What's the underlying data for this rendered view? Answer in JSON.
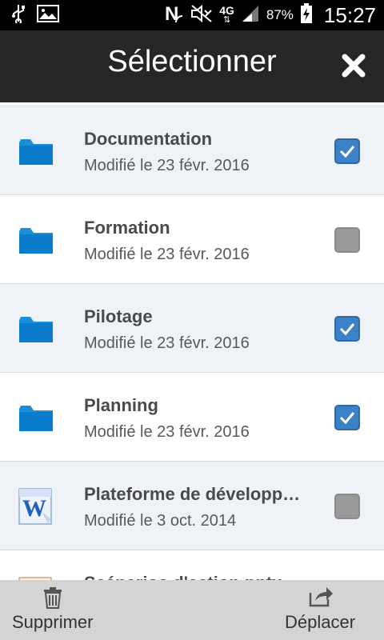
{
  "status_bar": {
    "battery": "87%",
    "network": "4G",
    "time": "15:27",
    "icons": [
      "usb-icon",
      "image-icon",
      "nfc-icon",
      "mute-icon",
      "signal-icon",
      "battery-charging-icon"
    ]
  },
  "header": {
    "title": "Sélectionner",
    "close_icon": "close-icon"
  },
  "items": [
    {
      "title": "Documentation",
      "subtitle": "Modifié le 23 févr. 2016",
      "icon": "folder-icon",
      "checked": true
    },
    {
      "title": "Formation",
      "subtitle": "Modifié le 23 févr. 2016",
      "icon": "folder-icon",
      "checked": false
    },
    {
      "title": "Pilotage",
      "subtitle": "Modifié le 23 févr. 2016",
      "icon": "folder-icon",
      "checked": true
    },
    {
      "title": "Planning",
      "subtitle": "Modifié le 23 févr. 2016",
      "icon": "folder-icon",
      "checked": true
    },
    {
      "title": "Plateforme de développ…",
      "subtitle": "Modifié le 3 oct. 2014",
      "icon": "word-document-icon",
      "checked": false
    },
    {
      "title": "Scénarios d'action pptx",
      "subtitle": "",
      "icon": "powerpoint-document-icon",
      "checked": false
    }
  ],
  "bottom_bar": {
    "delete_label": "Supprimer",
    "move_label": "Déplacer"
  },
  "colors": {
    "selected_row_bg": "#eff3f8",
    "checkbox_checked": "#3d82c8",
    "checkbox_unchecked": "#9a9a9a",
    "folder_blue": "#1a8fd8",
    "appbar": "#262626"
  }
}
